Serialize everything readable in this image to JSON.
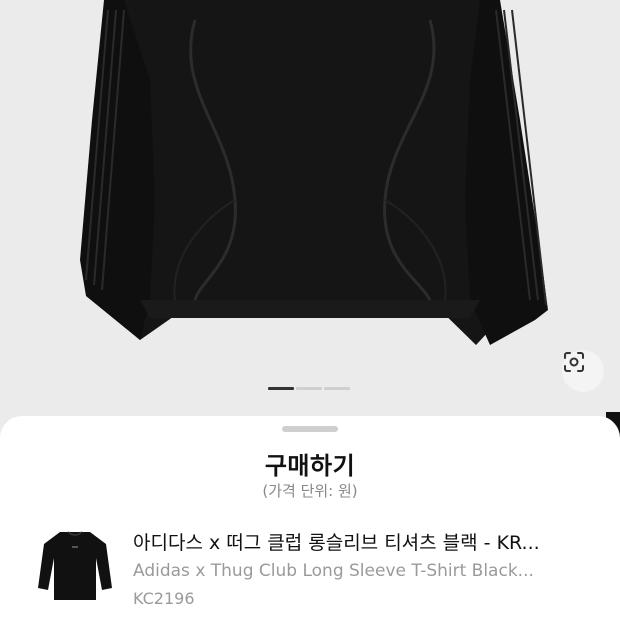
{
  "sheet": {
    "title": "구매하기",
    "subtitle": "(가격 단위: 원)"
  },
  "product": {
    "name_ko": "아디다스 x 떠그 클럽 롱슬리브 티셔츠 블랙 - KR...",
    "name_en": "Adidas x Thug Club Long Sleeve T-Shirt Black...",
    "model_code": "KC2196"
  },
  "carousel": {
    "total": 3,
    "active_index": 0
  },
  "icons": {
    "lens": "visual-search-icon"
  },
  "colors": {
    "background": "#ebebeb",
    "garment": "#111111",
    "sheet": "#ffffff",
    "muted_text": "#9a9a9a"
  }
}
